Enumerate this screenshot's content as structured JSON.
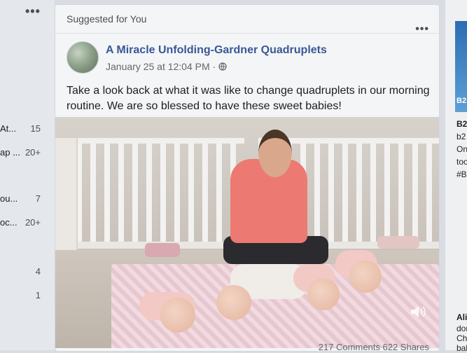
{
  "left_sidebar": {
    "more_glyph": "•••",
    "rows": [
      {
        "label": "At...",
        "count": "15"
      },
      {
        "label": "ap ...",
        "count": "20+"
      },
      {
        "label": "ou...",
        "count": "7"
      },
      {
        "label": "oc...",
        "count": "20+"
      },
      {
        "label": "",
        "count": "4"
      },
      {
        "label": "",
        "count": "1"
      }
    ]
  },
  "card": {
    "header": "Suggested for You",
    "menu_glyph": "•••",
    "page_name": "A Miracle Unfolding-Gardner Quadruplets",
    "timestamp": "January 25 at 12:04 PM",
    "separator": "·",
    "privacy_icon": "globe-icon",
    "text": "Take a look back at what it was like to change quadruplets in our morning routine. We are so blessed to have these sweet babies!",
    "video_volume_icon": "volume-icon",
    "stats": "217 Comments  622 Shares"
  },
  "right_ads": {
    "thumb_text": "B2",
    "lines": [
      "B2",
      "b2",
      "On",
      "too",
      "#B"
    ],
    "lines2": [
      "Ali",
      "dor",
      "Ch",
      "bal"
    ]
  },
  "colors": {
    "link": "#385898",
    "secondary_text": "#616770",
    "card_bg": "#f4f5f6"
  }
}
